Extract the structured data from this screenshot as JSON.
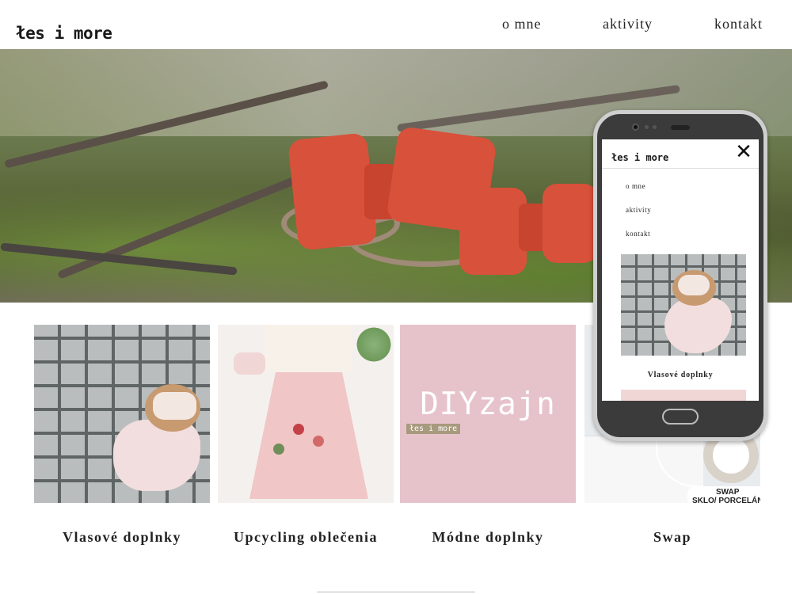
{
  "header": {
    "logo": "łes i more",
    "nav": [
      {
        "label": "o mne"
      },
      {
        "label": "aktivity"
      },
      {
        "label": "kontakt"
      }
    ]
  },
  "categories": [
    {
      "title": "Vlasové doplnky"
    },
    {
      "title": "Upcycling oblečenia"
    },
    {
      "title": "Módne doplnky",
      "image_text": "DIYzajn",
      "image_tag": "łes i more"
    },
    {
      "title": "Swap",
      "image_text": "SWAP\nSKLO/ PORCELÁN"
    }
  ],
  "mobile_preview": {
    "logo": "łes i more",
    "close_symbol": "✕",
    "menu": [
      {
        "label": "o mne"
      },
      {
        "label": "aktivity"
      },
      {
        "label": "kontakt"
      }
    ],
    "first_card_title": "Vlasové doplnky"
  },
  "colors": {
    "accent_pink": "#e6c3cb",
    "bow_red": "#d8513a"
  }
}
